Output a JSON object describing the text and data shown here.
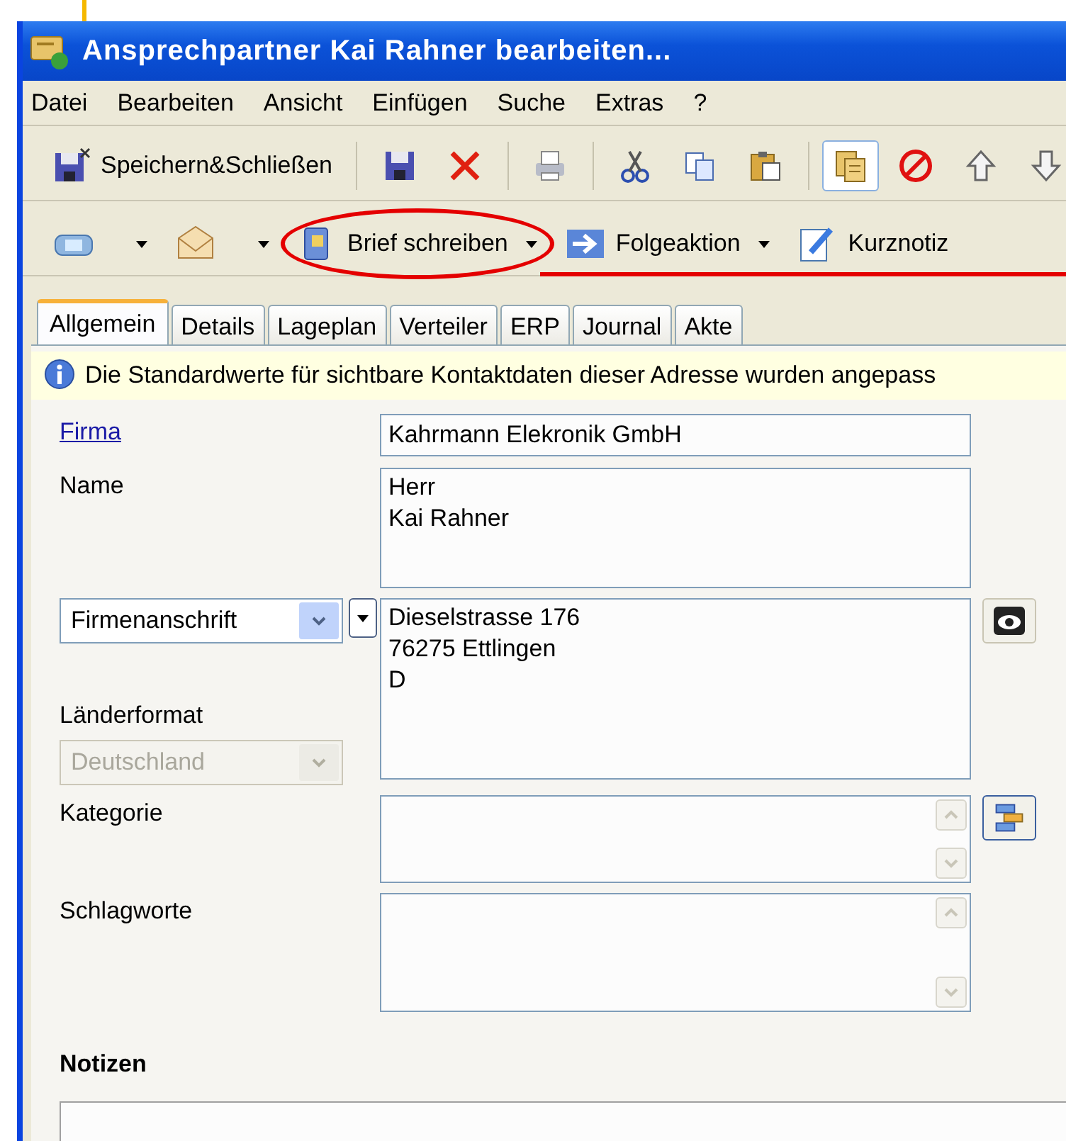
{
  "window": {
    "title": "Ansprechpartner Kai Rahner bearbeiten..."
  },
  "menu": [
    "Datei",
    "Bearbeiten",
    "Ansicht",
    "Einfügen",
    "Suche",
    "Extras",
    "?"
  ],
  "toolbar": {
    "save_close_label": "Speichern&Schließen",
    "layout_pressed": true
  },
  "actions": [
    {
      "kind": "phone",
      "circled": false
    },
    {
      "kind": "mail",
      "circled": false
    },
    {
      "kind": "letter",
      "label": "Brief schreiben",
      "circled": true
    },
    {
      "kind": "followup",
      "label": "Folgeaktion",
      "circled": false
    },
    {
      "kind": "note",
      "label": "Kurznotiz",
      "circled": false
    }
  ],
  "tabs": [
    {
      "label": "Allgemein",
      "selected": true
    },
    {
      "label": "Details",
      "selected": false
    },
    {
      "label": "Lageplan",
      "selected": false
    },
    {
      "label": "Verteiler",
      "selected": false
    },
    {
      "label": "ERP",
      "selected": false
    },
    {
      "label": "Journal",
      "selected": false
    },
    {
      "label": "Akte",
      "selected": false
    }
  ],
  "info": "Die Standardwerte für sichtbare Kontaktdaten dieser Adresse wurden angepass",
  "form": {
    "company_label": "Firma",
    "company": "Kahrmann Elekronik GmbH",
    "name_label": "Name",
    "name_lines": [
      "Herr",
      "Kai Rahner"
    ],
    "address_type": "Firmenanschrift",
    "address_lines": [
      "Dieselstrasse 176",
      "76275 Ettlingen",
      "D"
    ],
    "country_format_label": "Länderformat",
    "country": "Deutschland",
    "country_disabled": true,
    "category_label": "Kategorie",
    "keywords_label": "Schlagworte",
    "notes_label": "Notizen"
  }
}
